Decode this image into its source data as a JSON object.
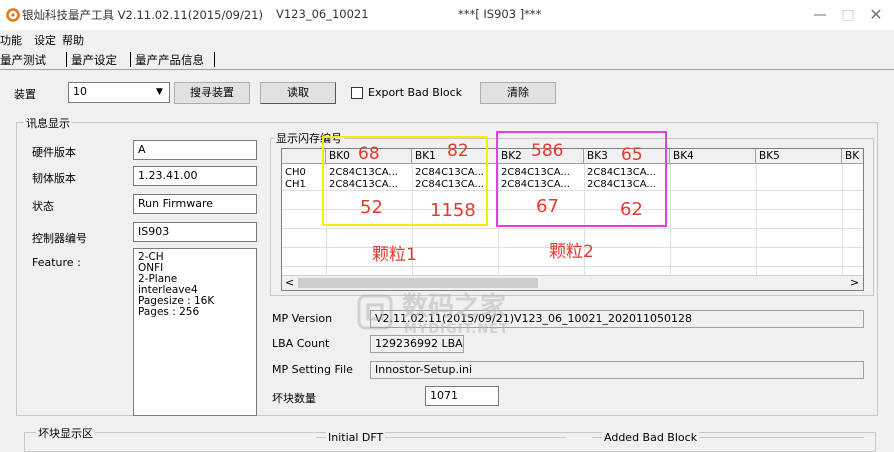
{
  "window": {
    "title_part1": "银灿科技量产工具 V2.11.02.11(2015/09/21)",
    "title_part2": "V123_06_10021",
    "title_part3": "***[ IS903 ]***",
    "minimize": "—",
    "maximize": "□",
    "close": "✕"
  },
  "menu": [
    "功能",
    "设定",
    "帮助"
  ],
  "tabs": [
    "量产测试",
    "量产设定",
    "量产产品信息"
  ],
  "toolbar": {
    "device_label": "装置",
    "device_value": "10",
    "search_button": "搜寻装置",
    "read_button": "读取",
    "export_bad_block_label": "Export Bad Block",
    "clear_button": "清除"
  },
  "info_group": {
    "title": "讯息显示",
    "hardware_version_label": "硬件版本",
    "hardware_version_value": "A",
    "firmware_version_label": "韧体版本",
    "firmware_version_value": "1.23.41.00",
    "status_label": "状态",
    "status_value": "Run Firmware",
    "controller_label": "控制器编号",
    "controller_value": "IS903",
    "feature_label": "Feature :",
    "feature_lines": [
      "2-CH",
      "ONFI",
      "2-Plane",
      "interleave4",
      "Pagesize : 16K",
      "Pages : 256"
    ]
  },
  "flash_group": {
    "title": "显示闪存编号",
    "columns": [
      "BK0",
      "BK1",
      "BK2",
      "BK3",
      "BK4",
      "BK5",
      "BK"
    ],
    "rows": [
      {
        "label": "CH0",
        "cells": [
          "2C84C13CA...",
          "2C84C13CA...",
          "2C84C13CA...",
          "2C84C13CA..."
        ]
      },
      {
        "label": "CH1",
        "cells": [
          "2C84C13CA...",
          "2C84C13CA...",
          "2C84C13CA...",
          "2C84C13CA..."
        ]
      }
    ],
    "scroll_left": "<",
    "scroll_right": ">"
  },
  "annotations": {
    "bk0_top": "68",
    "bk1_top": "82",
    "bk0_bottom": "52",
    "bk1_bottom": "1158",
    "bk2_top": "586",
    "bk3_top": "65",
    "bk2_bottom": "67",
    "bk3_bottom": "62",
    "chip1": "颗粒1",
    "chip2": "颗粒2"
  },
  "mp_info": {
    "mp_version_label": "MP Version",
    "mp_version_value": "V2.11.02.11(2015/09/21)V123_06_10021_202011050128",
    "lba_count_label": "LBA Count",
    "lba_count_value": "129236992 LBAs",
    "mp_setting_label": "MP Setting File",
    "mp_setting_value": "Innostor-Setup.ini",
    "bad_block_count_label": "坏块数量",
    "bad_block_count_value": "1071"
  },
  "bad_block_group": {
    "title": "坏块显示区",
    "initial_label": "Initial DFT",
    "added_label": "Added Bad Block"
  },
  "watermark": {
    "line1": "数码之家",
    "line2": "MYDIGIT.NET"
  },
  "colors": {
    "annotation_red": "#e23a2e",
    "yellow_box": "#f4f000",
    "magenta_box": "#e63be6",
    "app_icon_orange": "#e8751a"
  }
}
